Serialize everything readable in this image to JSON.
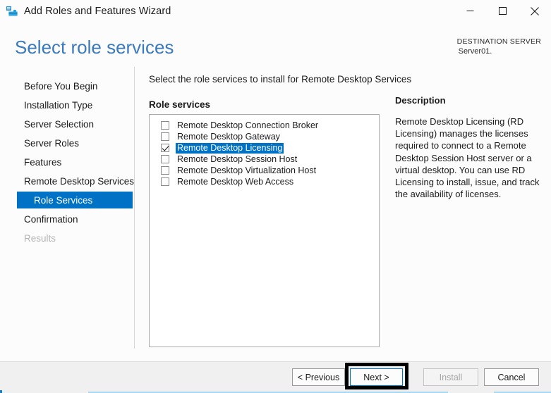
{
  "window": {
    "title": "Add Roles and Features Wizard",
    "icon": "server-toolbox-icon",
    "controls": {
      "minimize": "minimize-icon",
      "maximize": "maximize-icon",
      "close": "close-icon"
    }
  },
  "header": {
    "page_title": "Select role services",
    "destination_label": "DESTINATION SERVER",
    "destination_server": "Server01.",
    "title_color": "#3a7abd"
  },
  "sidebar": {
    "items": [
      {
        "label": "Before You Begin",
        "state": "normal",
        "sub": false
      },
      {
        "label": "Installation Type",
        "state": "normal",
        "sub": false
      },
      {
        "label": "Server Selection",
        "state": "normal",
        "sub": false
      },
      {
        "label": "Server Roles",
        "state": "normal",
        "sub": false
      },
      {
        "label": "Features",
        "state": "normal",
        "sub": false
      },
      {
        "label": "Remote Desktop Services",
        "state": "normal",
        "sub": false
      },
      {
        "label": "Role Services",
        "state": "selected",
        "sub": true
      },
      {
        "label": "Confirmation",
        "state": "normal",
        "sub": false
      },
      {
        "label": "Results",
        "state": "disabled",
        "sub": false
      }
    ],
    "selected_color": "#0072c6"
  },
  "main": {
    "instruction": "Select the role services to install for Remote Desktop Services",
    "section_label": "Role services",
    "role_services": [
      {
        "label": "Remote Desktop Connection Broker",
        "checked": false,
        "selected": false
      },
      {
        "label": "Remote Desktop Gateway",
        "checked": false,
        "selected": false
      },
      {
        "label": "Remote Desktop Licensing",
        "checked": true,
        "selected": true
      },
      {
        "label": "Remote Desktop Session Host",
        "checked": false,
        "selected": false
      },
      {
        "label": "Remote Desktop Virtualization Host",
        "checked": false,
        "selected": false
      },
      {
        "label": "Remote Desktop Web Access",
        "checked": false,
        "selected": false
      }
    ]
  },
  "description": {
    "title": "Description",
    "text": "Remote Desktop Licensing (RD Licensing) manages the licenses required to connect to a Remote Desktop Session Host server or a virtual desktop. You can use RD Licensing to install, issue, and track the availability of licenses."
  },
  "footer": {
    "previous_label": "< Previous",
    "next_label": "Next >",
    "install_label": "Install",
    "cancel_label": "Cancel",
    "install_enabled": false,
    "next_focused": true,
    "annotation": "highlight-box-around-next-button"
  }
}
